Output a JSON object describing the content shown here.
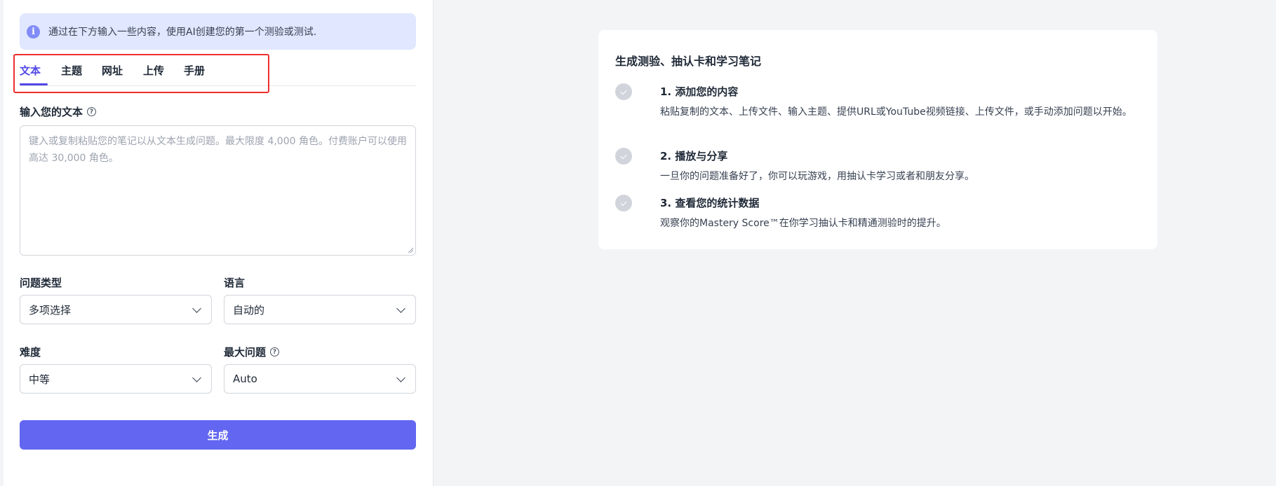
{
  "banner": {
    "text": "通过在下方输入一些内容，使用AI创建您的第一个测验或测试."
  },
  "tabs": [
    {
      "label": "文本",
      "active": true
    },
    {
      "label": "主题",
      "active": false
    },
    {
      "label": "网址",
      "active": false
    },
    {
      "label": "上传",
      "active": false
    },
    {
      "label": "手册",
      "active": false
    }
  ],
  "input": {
    "label": "输入您的文本",
    "value": "",
    "placeholder": "键入或复制粘贴您的笔记以从文本生成问题。最大限度 4,000 角色。付费账户可以使用高达 30,000 角色。"
  },
  "options": {
    "question_type": {
      "label": "问题类型",
      "value": "多项选择"
    },
    "language": {
      "label": "语言",
      "value": "自动的"
    },
    "difficulty": {
      "label": "难度",
      "value": "中等"
    },
    "max_questions": {
      "label": "最大问题",
      "value": "Auto"
    }
  },
  "generate_label": "生成",
  "card": {
    "title": "生成测验、抽认卡和学习笔记",
    "steps": [
      {
        "title": "1. 添加您的内容",
        "desc": "粘贴复制的文本、上传文件、输入主题、提供URL或YouTube视频链接、上传文件，或手动添加问题以开始。"
      },
      {
        "title": "2. 播放与分享",
        "desc": "一旦你的问题准备好了，你可以玩游戏，用抽认卡学习或者和朋友分享。"
      },
      {
        "title": "3. 查看您的统计数据",
        "desc": "观察你的Mastery Score™在你学习抽认卡和精通测验时的提升。"
      }
    ]
  },
  "colors": {
    "accent": "#6366f1",
    "tab_active": "#4f46e5",
    "banner_bg": "#e0e7ff",
    "highlight": "#ef2e2e",
    "page_bg": "#f3f4f6"
  },
  "icons": {
    "info": "info-icon",
    "help": "help-circle-icon",
    "chevron": "chevron-down-icon",
    "check": "check-circle-icon"
  }
}
